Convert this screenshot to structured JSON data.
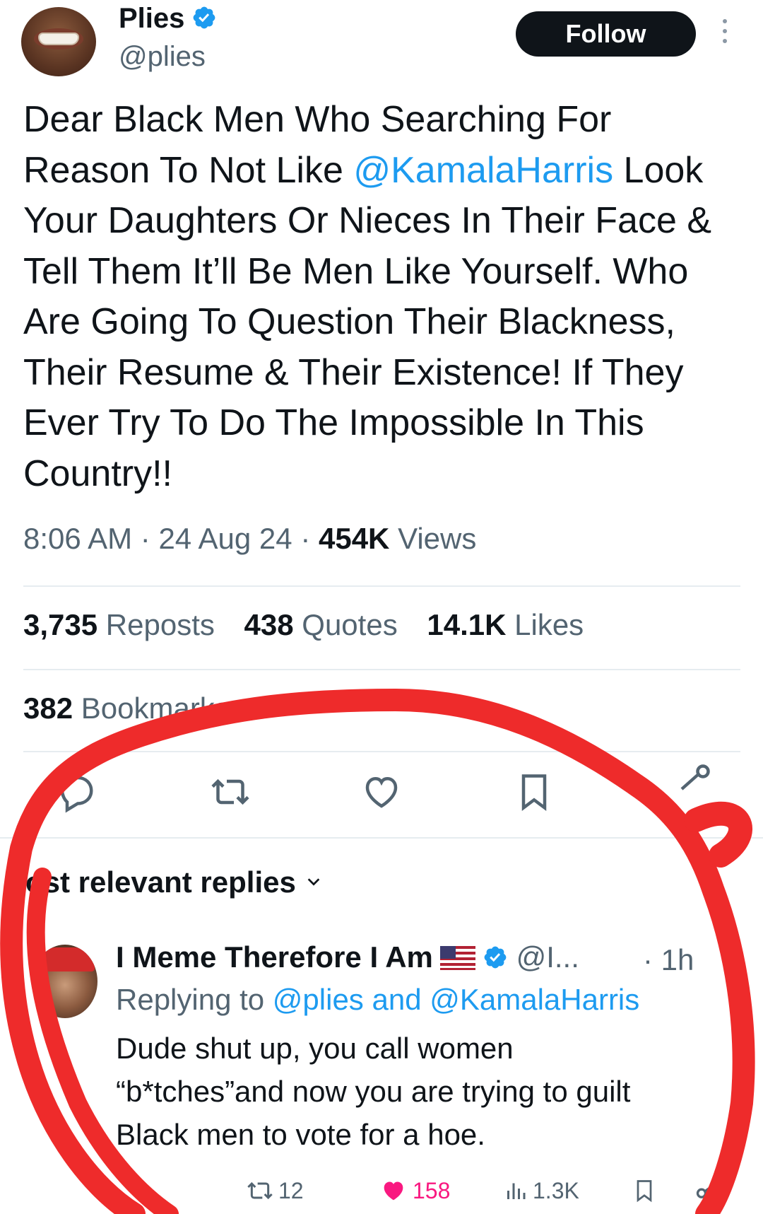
{
  "tweet": {
    "author_name": "Plies",
    "author_handle": "@plies",
    "follow_label": "Follow",
    "text_before": "Dear Black Men Who Searching For Reason To Not Like ",
    "mention": "@KamalaHarris",
    "text_after": " Look Your Daughters Or Nieces In Their Face & Tell Them It’ll Be Men Like Yourself. Who Are Going To Question Their Blackness, Their Resume & Their Existence! If They Ever Try To Do The Impossible In This Country!!",
    "time": "8:06 AM",
    "sep": "·",
    "date": "24 Aug 24",
    "views_count": "454K",
    "views_label": "Views"
  },
  "stats": {
    "reposts_count": "3,735",
    "reposts_label": "Reposts",
    "quotes_count": "438",
    "quotes_label": "Quotes",
    "likes_count": "14.1K",
    "likes_label": "Likes",
    "bookmarks_count": "382",
    "bookmarks_label": "Bookmarks"
  },
  "actions": [
    "reply-icon",
    "repost-icon",
    "like-icon",
    "bookmark-icon",
    "share-icon"
  ],
  "replies": {
    "section_label": "ost relevant replies",
    "reply": {
      "name": "I Meme Therefore I Am",
      "handle": "@I...",
      "time": "· 1h",
      "replying_prefix": "Replying to",
      "replying_mentions": "@plies and @KamalaHarris",
      "text_line1": "Dude shut up, you call women",
      "text_line2": "“b*tches”and now you are trying to guilt",
      "text_line3": "Black men to vote for a hoe.",
      "reposts": "12",
      "likes": "158",
      "views": "1.3K"
    }
  },
  "colors": {
    "accent": "#1d9bf0",
    "text": "#0f1419",
    "muted": "#536471",
    "like": "#f91880",
    "annotation": "#ee2b2b"
  }
}
